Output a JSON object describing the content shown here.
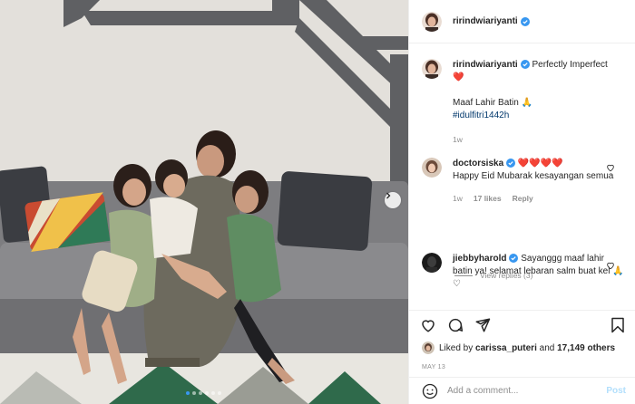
{
  "post": {
    "username": "ririndwiariyanti",
    "caption_text": "Perfectly Imperfect",
    "caption_heart": "❤️",
    "caption_line2": "Maaf Lahir Batin 🙏",
    "hashtag": "#idulfitri1442h",
    "caption_age": "1w"
  },
  "comments": [
    {
      "username": "doctorsiska",
      "text": "Happy Eid Mubarak kesayangan semua",
      "hearts": "❤️❤️❤️❤️",
      "age": "1w",
      "likes": "17 likes",
      "reply": "Reply",
      "view_replies": "View replies (3)"
    },
    {
      "username": "jiebbyharold",
      "text": "Sayanggg maaf lahir batin ya! selamat lebaran salm buat kel 🙏♡"
    }
  ],
  "likes": {
    "prefix": "Liked by",
    "user": "carissa_puteri",
    "and": "and",
    "count": "17,149 others"
  },
  "date": "MAY 13",
  "add_comment": {
    "placeholder": "Add a comment...",
    "post_label": "Post"
  },
  "carousel": {
    "slides": 6,
    "active": 1
  },
  "colors": {
    "verified": "#3897f0",
    "link": "#00376b",
    "muted": "#8e8e8e",
    "post_disabled": "#b2dffc",
    "heart": "#ed4956"
  },
  "icons": [
    "chevron-right-icon",
    "verified-badge-icon",
    "heart-icon",
    "comment-icon",
    "share-icon",
    "bookmark-icon",
    "emoji-icon"
  ]
}
